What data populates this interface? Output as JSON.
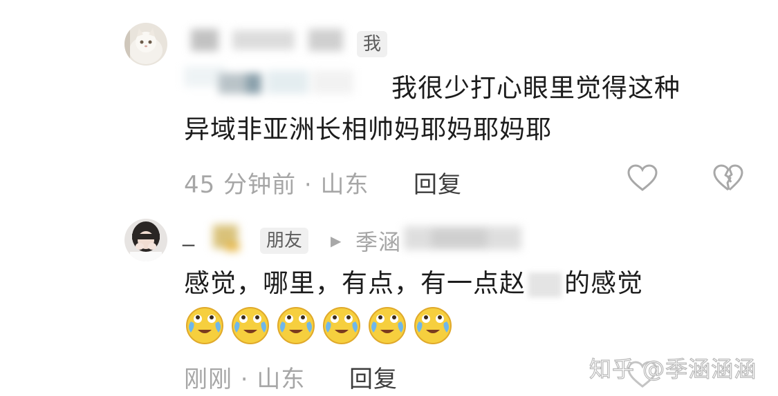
{
  "comments": [
    {
      "badge": "我",
      "text_line1": "我很少打心眼里觉得这种",
      "text_line2": "异域非亚洲长相帅妈耶妈耶妈耶",
      "time_location": "45 分钟前 · 山东",
      "reply_label": "回复"
    },
    {
      "username_prefix": "_",
      "friend_badge": "朋友",
      "reply_arrow": "▶",
      "reply_to": "季涵",
      "text": "感觉，哪里，有点，有一点赵",
      "text_tail": "的感觉",
      "emojis": [
        "crying-laughing",
        "crying-laughing",
        "crying-laughing",
        "crying-laughing",
        "crying-laughing",
        "crying-laughing"
      ],
      "time_location": "刚刚 · 山东",
      "reply_label": "回复"
    }
  ],
  "watermark": "知乎 @季涵涵涵",
  "colors": {
    "meta": "#a6a6a6",
    "text": "#1c1c1c",
    "icon": "#a8a8a8"
  }
}
